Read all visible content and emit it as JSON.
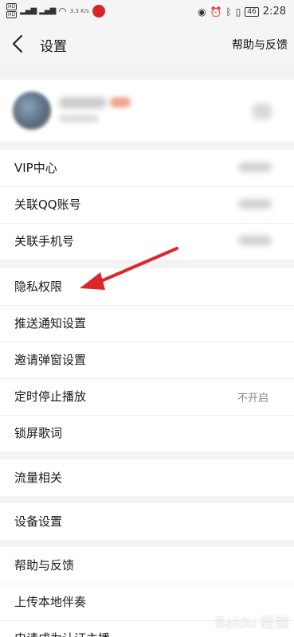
{
  "status_bar": {
    "hd1": "HD",
    "hd2": "HD",
    "net1": "4G",
    "net2": "4G",
    "speed": "3.3 K/s",
    "battery": "46",
    "time": "2:28"
  },
  "nav": {
    "title": "设置",
    "help": "帮助与反馈"
  },
  "groups": {
    "account": {
      "vip": "VIP中心",
      "qq": "关联QQ账号",
      "phone": "关联手机号"
    },
    "privacy": {
      "privacy": "隐私权限",
      "push": "推送通知设置",
      "invite": "邀请弹窗设置",
      "timer": "定时停止播放",
      "timer_value": "不开启",
      "lyrics": "锁屏歌词"
    },
    "data": {
      "traffic": "流量相关"
    },
    "device": {
      "device": "设备设置"
    },
    "misc": {
      "help": "帮助与反馈",
      "upload": "上传本地伴奏",
      "apply": "申请成为认证主播"
    }
  },
  "watermark": "Baidu 经验",
  "colors": {
    "arrow": "#e0252a",
    "status_badge": "#d6262c"
  }
}
